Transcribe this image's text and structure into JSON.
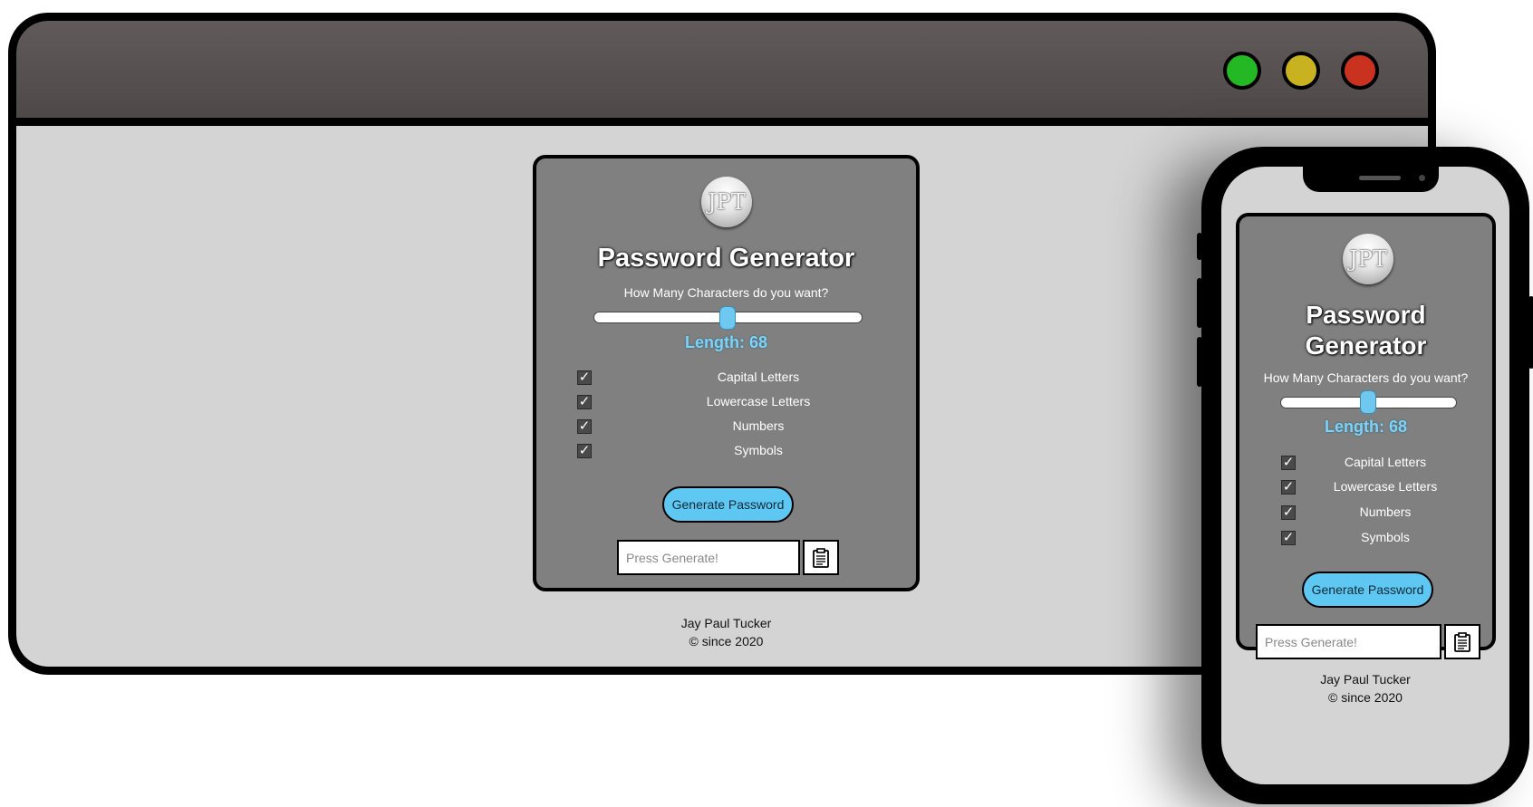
{
  "app": {
    "logo_text": "JPT",
    "title": "Password Generator",
    "title_line1": "Password",
    "title_line2": "Generator",
    "question": "How Many Characters do you want?",
    "length_label": "Length: 68",
    "length_value": 68,
    "options": [
      {
        "label": "Capital Letters",
        "checked": true
      },
      {
        "label": "Lowercase Letters",
        "checked": true
      },
      {
        "label": "Numbers",
        "checked": true
      },
      {
        "label": "Symbols",
        "checked": true
      }
    ],
    "generate_label": "Generate Password",
    "password_placeholder": "Press Generate!",
    "footer_name": "Jay Paul Tucker",
    "footer_copy": "© since 2020"
  },
  "icons": {
    "clipboard": "clipboard-icon",
    "checkmark": "check-icon"
  },
  "colors": {
    "accent": "#5ec7f2",
    "card": "#808080",
    "page": "#d4d4d4",
    "dot_green": "#24b824",
    "dot_yellow": "#c8b21f",
    "dot_red": "#c9321e"
  }
}
